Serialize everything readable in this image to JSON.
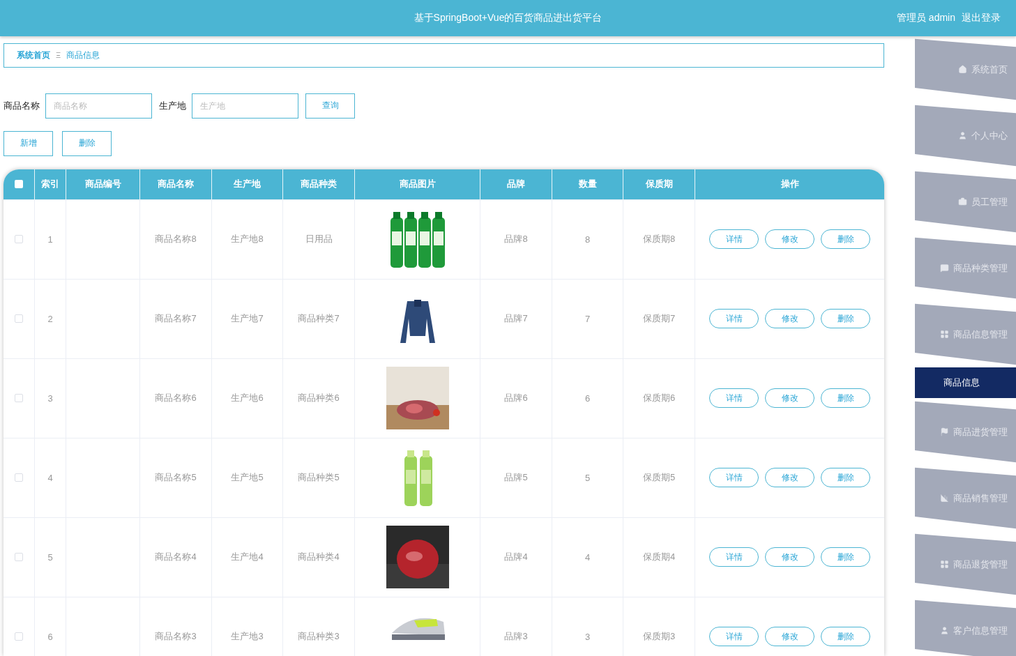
{
  "header": {
    "title": "基于SpringBoot+Vue的百货商品进出货平台",
    "user": "管理员 admin",
    "logout": "退出登录"
  },
  "breadcrumb": [
    "系统首页",
    "商品信息"
  ],
  "breadcrumb_separator": "Ξ",
  "search": {
    "fields": [
      {
        "label": "商品名称",
        "placeholder": "商品名称"
      },
      {
        "label": "生产地",
        "placeholder": "生产地"
      }
    ],
    "button": "查询"
  },
  "actions": [
    "新增",
    "删除"
  ],
  "table": {
    "header_checkbox": {
      "checked": false
    },
    "columns": [
      "索引",
      "商品编号",
      "商品名称",
      "生产地",
      "商品种类",
      "商品图片",
      "品牌",
      "数量",
      "保质期",
      "操作"
    ],
    "rows": [
      {
        "checked": false,
        "index": "1",
        "name": "商品名称8",
        "origin": "生产地8",
        "category": "日用品",
        "brand": "品牌8",
        "qty": "8",
        "shelf": "保质期8",
        "buttons": [
          "详情",
          "修改",
          "删除"
        ]
      },
      {
        "checked": false,
        "index": "2",
        "name": "商品名称7",
        "origin": "生产地7",
        "category": "商品种类7",
        "brand": "品牌7",
        "qty": "7",
        "shelf": "保质期7",
        "buttons": [
          "详情",
          "修改",
          "删除"
        ]
      },
      {
        "checked": false,
        "index": "3",
        "name": "商品名称6",
        "origin": "生产地6",
        "category": "商品种类6",
        "brand": "品牌6",
        "qty": "6",
        "shelf": "保质期6",
        "buttons": [
          "详情",
          "修改",
          "删除"
        ]
      },
      {
        "checked": false,
        "index": "4",
        "name": "商品名称5",
        "origin": "生产地5",
        "category": "商品种类5",
        "brand": "品牌5",
        "qty": "5",
        "shelf": "保质期5",
        "buttons": [
          "详情",
          "修改",
          "删除"
        ]
      },
      {
        "checked": false,
        "index": "5",
        "name": "商品名称4",
        "origin": "生产地4",
        "category": "商品种类4",
        "brand": "品牌4",
        "qty": "4",
        "shelf": "保质期4",
        "buttons": [
          "详情",
          "修改",
          "删除"
        ]
      },
      {
        "checked": false,
        "index": "6",
        "name": "商品名称3",
        "origin": "生产地3",
        "category": "商品种类3",
        "brand": "品牌3",
        "qty": "3",
        "shelf": "保质期3",
        "buttons": [
          "详情",
          "修改",
          "删除"
        ]
      }
    ]
  },
  "sidebar": {
    "items": [
      {
        "label": "系统首页",
        "selected": false
      },
      {
        "label": "个人中心",
        "selected": false
      },
      {
        "label": "员工管理",
        "selected": false
      },
      {
        "label": "商品种类管理",
        "selected": false
      },
      {
        "label": "商品信息管理",
        "selected": false
      },
      {
        "label": "商品信息",
        "selected": true
      },
      {
        "label": "商品进货管理",
        "selected": false
      },
      {
        "label": "商品销售管理",
        "selected": false
      },
      {
        "label": "商品退货管理",
        "selected": false
      },
      {
        "label": "客户信息管理",
        "selected": false
      }
    ]
  }
}
